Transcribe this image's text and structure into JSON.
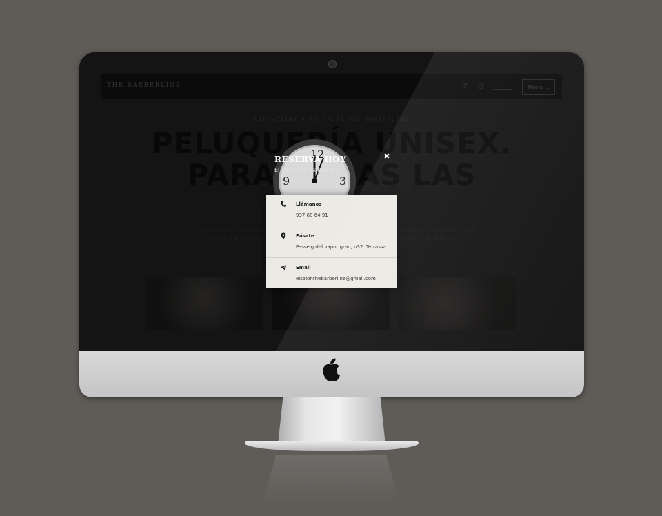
{
  "site": {
    "brand": "THE BARBERLINE",
    "menu_label": "Menu",
    "hero_kicker": "BIENVENIDO A EL SALÓN THE BARBERLINE",
    "hero_title_line1": "PELUQUERÍA UNISEX.",
    "hero_title_line2": "PARA TODAS LAS",
    "hero_text": "Cuidamos cada cliente como único. Te asesoramos para expresar tu estilo y personalidad. Encuentra tu look ideal con nuestros profesionales y las últimas tendencias."
  },
  "modal": {
    "title": "RESERVA HOY",
    "subtitle": "El Salón The Barberline",
    "close_icon": "close-icon",
    "contacts": [
      {
        "icon": "phone-icon",
        "label": "Llámanos",
        "value": "937 68 64 91"
      },
      {
        "icon": "map-pin-icon",
        "label": "Pásate",
        "value": "Passeig del vapor gran, n32. Terrassa"
      },
      {
        "icon": "paper-plane-icon",
        "label": "Email",
        "value": "elsalonthebarberline@gmail.com"
      }
    ]
  },
  "colors": {
    "background": "#5f5c58",
    "card": "#eceae4",
    "screen": "#1f1f1f"
  }
}
